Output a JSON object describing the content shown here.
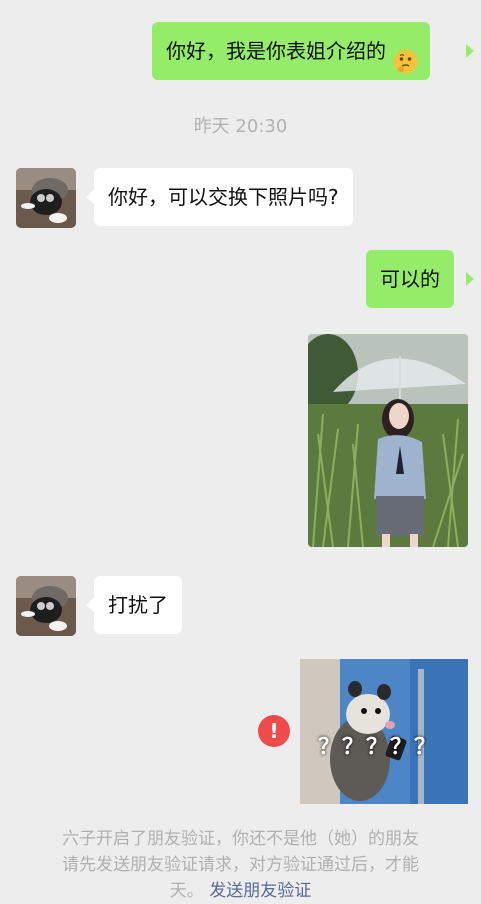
{
  "messages": {
    "intro": "你好，我是你表姐介绍的",
    "timestamp": "昨天 20:30",
    "ask_photo": "你好，可以交换下照片吗?",
    "reply_ok": "可以的",
    "disturb": "打扰了",
    "sticker_text": "？？？？？"
  },
  "system_notice": {
    "line1": "六子开启了朋友验证，你还不是他（她）的朋友",
    "line2": "请先发送朋友验证请求，对方验证通过后，才能",
    "line3_prefix": "天。",
    "link": "发送朋友验证"
  },
  "failed_indicator": "!",
  "colors": {
    "background": "#ededed",
    "my_bubble": "#95ec69",
    "other_bubble": "#ffffff",
    "error_red": "#f04a4a",
    "link": "#576b95"
  },
  "icons": {
    "emoji": "thinking-face-icon"
  }
}
